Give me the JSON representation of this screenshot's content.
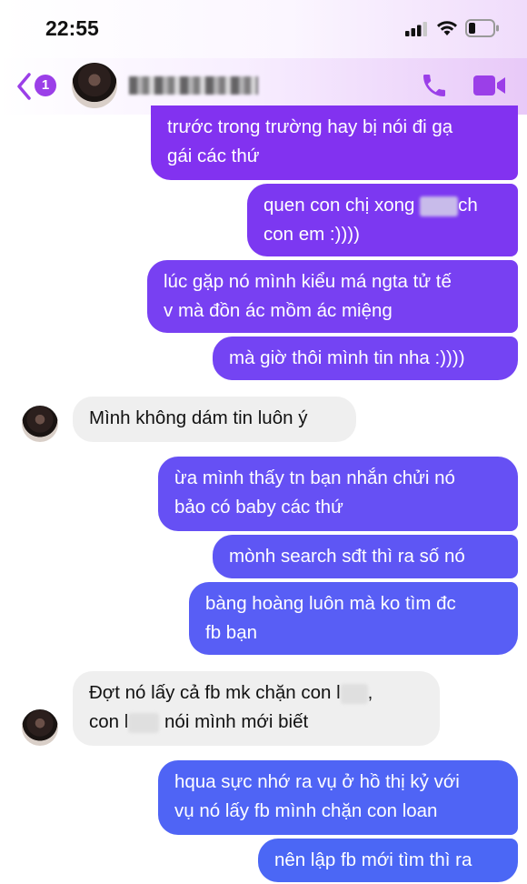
{
  "status_bar": {
    "time": "22:55"
  },
  "header": {
    "unread_count": "1",
    "contact_name": ""
  },
  "messages": {
    "m1": {
      "line1": "trước trong trường hay bị nói đi gạ",
      "line2": "gái các thứ"
    },
    "m2": {
      "line1a": "quen con chị xong ",
      "line1b": "ch",
      "line2": "con em :))))"
    },
    "m3": {
      "line1": "lúc gặp nó mình kiểu má ngta tử tế",
      "line2": "v mà đồn ác mồm ác miệng"
    },
    "m4": {
      "line1": "mà giờ thôi mình tin nha :))))"
    },
    "m5": {
      "line1": "Mình không dám tin luôn ý"
    },
    "m6": {
      "line1": "ừa mình thấy tn bạn nhắn chửi nó",
      "line2": "bảo có baby các thứ"
    },
    "m7": {
      "line1": "mònh search sđt thì ra số nó"
    },
    "m8": {
      "line1": "bàng hoàng luôn mà ko tìm đc",
      "line2": "fb bạn"
    },
    "m9": {
      "line1a": "Đợt nó lấy cả fb mk chặn con l",
      "line1b": ",",
      "line2a": "con l",
      "line2b": "nói mình mới biết"
    },
    "m10": {
      "line1": "hqua sực nhớ ra vụ ở hồ thị kỷ với",
      "line2": "vụ nó lấy fb mình chặn con loan"
    },
    "m11": {
      "line1": "nên lập fb mới tìm thì ra"
    }
  },
  "colors": {
    "accent": "#9b3fe8",
    "bubble_top": "#8232f0",
    "bubble_mid": "#6a4cf5",
    "bubble_bottom": "#4c66f5",
    "incoming_bg": "#efefef"
  },
  "icons": {
    "back": "chevron-left-icon",
    "call": "phone-icon",
    "video": "video-camera-icon",
    "signal": "cellular-signal-icon",
    "wifi": "wifi-icon",
    "battery": "battery-icon"
  }
}
